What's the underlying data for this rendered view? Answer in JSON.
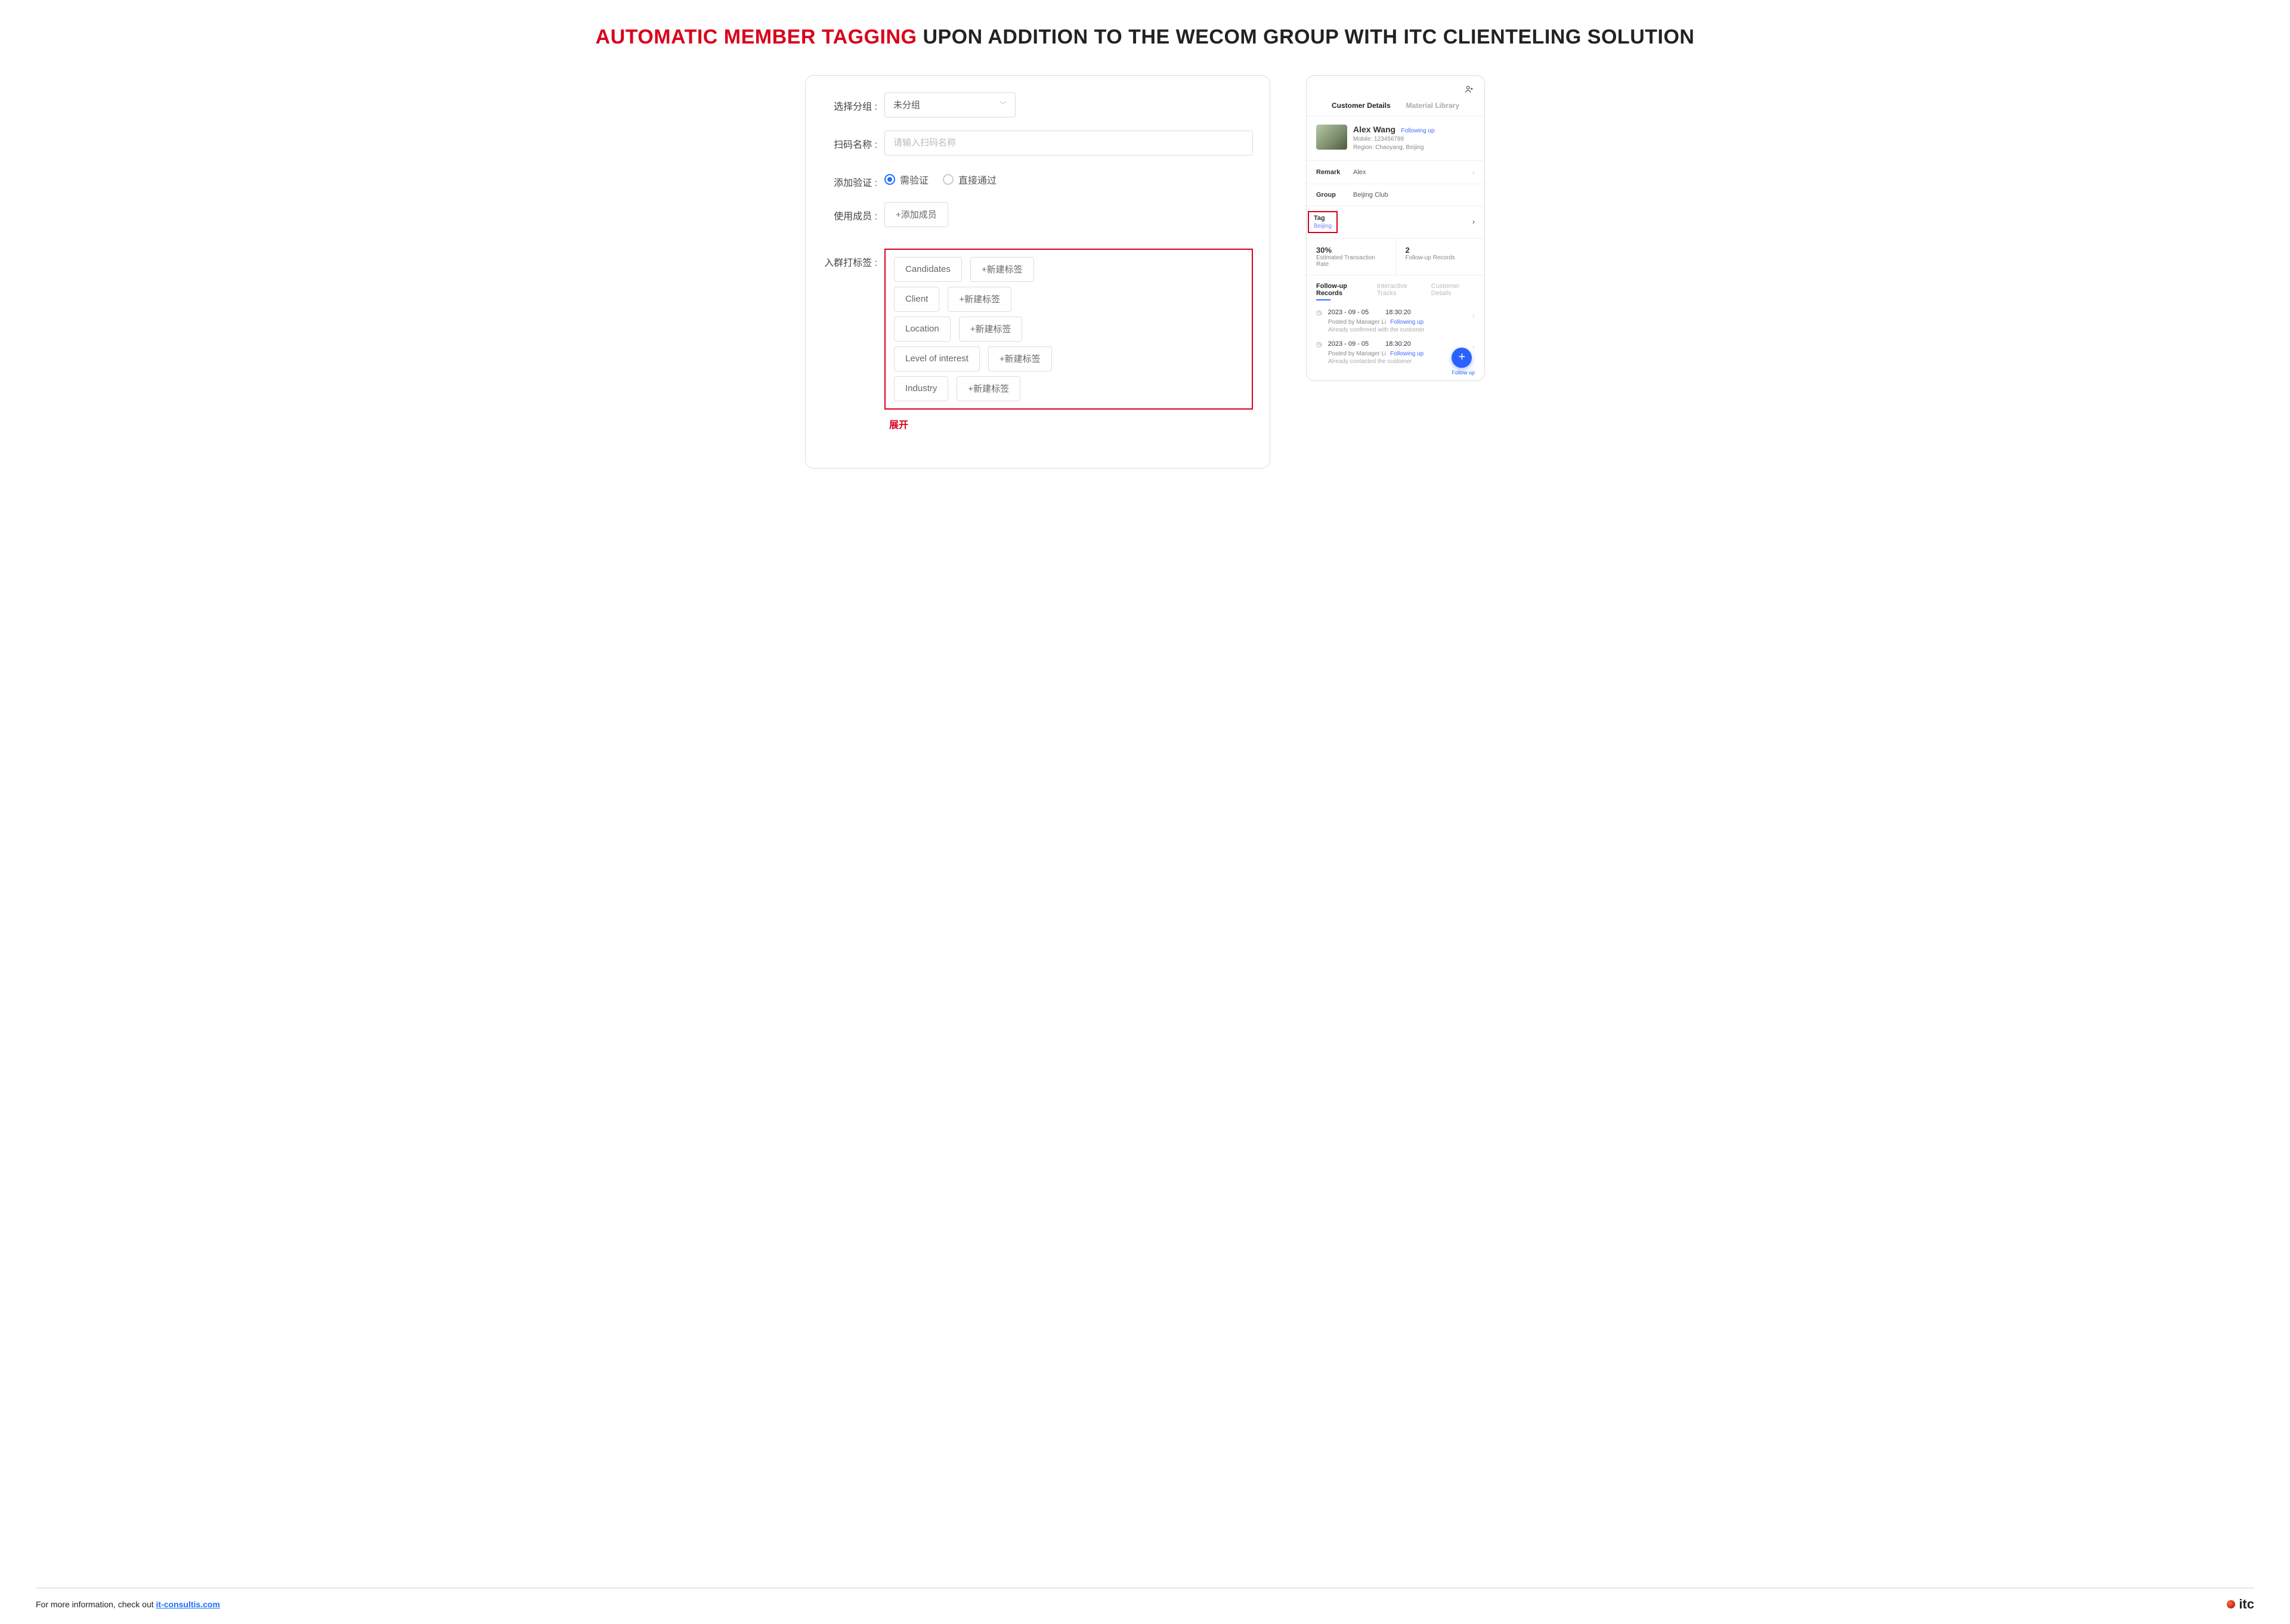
{
  "title": {
    "accent": "AUTOMATIC MEMBER TAGGING",
    "rest": " UPON ADDITION TO THE WECOM GROUP WITH ITC CLIENTELING SOLUTION"
  },
  "left_form": {
    "labels": {
      "select_group": "选择分组 :",
      "scan_name": "扫码名称 :",
      "verification": "添加验证 :",
      "members": "使用成员 :",
      "tag_on_join": "入群打标签 :"
    },
    "select_group_value": "未分组",
    "scan_name_placeholder": "请输入扫码名称",
    "verification_options": {
      "need": "需验证",
      "pass": "直接通过"
    },
    "add_member_button": "+添加成员",
    "tag_categories": [
      "Candidates",
      "Client",
      "Location",
      "Level of interest",
      "Industry"
    ],
    "new_tag_button": "+新建标签",
    "expand": "展开"
  },
  "mobile": {
    "tabs": {
      "details": "Customer Details",
      "library": "Material Library"
    },
    "customer": {
      "name": "Alex Wang",
      "status": "Following up",
      "mobile_label": "Mobile: ",
      "mobile": "123456789",
      "region_label": "Region: ",
      "region": "Chaoyang, Beijing"
    },
    "rows": {
      "remark_label": "Remark",
      "remark_value": "Alex",
      "group_label": "Group",
      "group_value": "Beijing Club",
      "tag_label": "Tag",
      "tag_value": "Beijing"
    },
    "stats": {
      "rate_value": "30%",
      "rate_label": "Estimated Transaction Rate",
      "records_value": "2",
      "records_label": "Follow-up Records"
    },
    "subtabs": {
      "records": "Follow-up Records",
      "tracks": "Interactive Tracks",
      "details": "Customer Details"
    },
    "records": [
      {
        "date": "2023 - 09 - 05",
        "time": "18:30:20",
        "posted_by": "Posted by Manager Li",
        "status": "Following up",
        "note": "Already confirmed with the customer"
      },
      {
        "date": "2023 - 09 - 05",
        "time": "18:30:20",
        "posted_by": "Posted by Manager Li",
        "status": "Following up",
        "note": "Already contacted the customer"
      }
    ],
    "fab_label": "Follow up"
  },
  "footer": {
    "prefix": "For more information, check out ",
    "link_text": "it-consultis.com",
    "brand": "itc"
  }
}
